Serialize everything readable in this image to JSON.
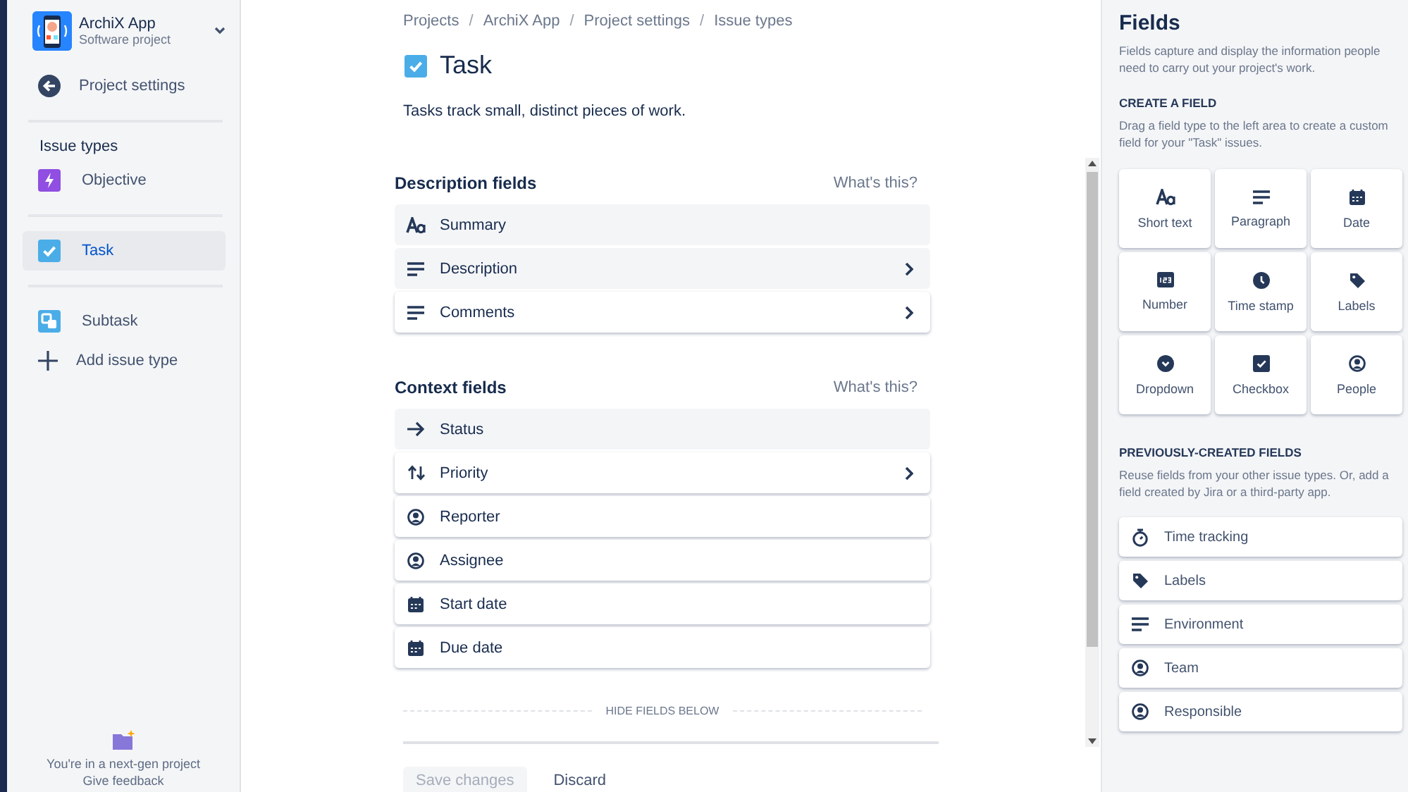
{
  "project": {
    "name": "ArchiX App",
    "type": "Software project"
  },
  "sidebar": {
    "back_link": "Project settings",
    "section_title": "Issue types",
    "items": [
      {
        "label": "Objective",
        "kind": "objective",
        "selected": false
      },
      {
        "label": "Task",
        "kind": "task",
        "selected": true
      },
      {
        "label": "Subtask",
        "kind": "subtask",
        "selected": false
      }
    ],
    "add_link": "Add issue type",
    "footer": {
      "notice": "You're in a next-gen project",
      "feedback": "Give feedback"
    }
  },
  "breadcrumbs": [
    {
      "kind": "link",
      "text": "Projects"
    },
    {
      "kind": "separator",
      "text": "/"
    },
    {
      "kind": "link",
      "text": "ArchiX App"
    },
    {
      "kind": "separator",
      "text": "/"
    },
    {
      "kind": "link",
      "text": "Project settings"
    },
    {
      "kind": "separator",
      "text": "/"
    },
    {
      "kind": "link",
      "text": "Issue types"
    }
  ],
  "issue_type": {
    "title": "Task",
    "description": "Tasks track small, distinct pieces of work."
  },
  "sections": [
    {
      "title": "Description fields",
      "help": "What's this?",
      "fields": [
        {
          "label": "Summary",
          "kind": "text",
          "fixed": true,
          "expandable": false
        },
        {
          "label": "Description",
          "kind": "lines",
          "fixed": true,
          "expandable": true
        },
        {
          "label": "Comments",
          "kind": "lines",
          "fixed": false,
          "expandable": true
        }
      ]
    },
    {
      "title": "Context fields",
      "help": "What's this?",
      "fields": [
        {
          "label": "Status",
          "kind": "arrow",
          "fixed": true,
          "expandable": false
        },
        {
          "label": "Priority",
          "kind": "updown",
          "fixed": false,
          "expandable": true
        },
        {
          "label": "Reporter",
          "kind": "person",
          "fixed": false,
          "expandable": false
        },
        {
          "label": "Assignee",
          "kind": "person",
          "fixed": false,
          "expandable": false
        },
        {
          "label": "Start date",
          "kind": "calendar",
          "fixed": false,
          "expandable": false
        },
        {
          "label": "Due date",
          "kind": "calendar",
          "fixed": false,
          "expandable": false
        }
      ]
    }
  ],
  "hide_divider": "HIDE FIELDS BELOW",
  "actions": [
    {
      "label": "Save changes",
      "kind": "primary",
      "disabled": true
    },
    {
      "label": "Discard",
      "kind": "subtle",
      "disabled": false
    }
  ],
  "fields_panel": {
    "title": "Fields",
    "description": "Fields capture and display the information people need to carry out your project's work.",
    "create": {
      "title": "CREATE A FIELD",
      "hint": "Drag a field type to the left area to create a custom field for your \"Task\" issues.",
      "types": [
        {
          "label": "Short text",
          "kind": "text"
        },
        {
          "label": "Paragraph",
          "kind": "lines"
        },
        {
          "label": "Date",
          "kind": "calendar"
        },
        {
          "label": "Number",
          "kind": "number"
        },
        {
          "label": "Time stamp",
          "kind": "clock"
        },
        {
          "label": "Labels",
          "kind": "tag"
        },
        {
          "label": "Dropdown",
          "kind": "dropdown"
        },
        {
          "label": "Checkbox",
          "kind": "checkbox"
        },
        {
          "label": "People",
          "kind": "person"
        }
      ]
    },
    "previous": {
      "title": "PREVIOUSLY-CREATED FIELDS",
      "hint": "Reuse fields from your other issue types. Or, add a field created by Jira or a third-party app.",
      "fields": [
        {
          "label": "Time tracking",
          "kind": "stopwatch"
        },
        {
          "label": "Labels",
          "kind": "tag"
        },
        {
          "label": "Environment",
          "kind": "lines"
        },
        {
          "label": "Team",
          "kind": "person"
        },
        {
          "label": "Responsible",
          "kind": "person"
        }
      ]
    }
  }
}
